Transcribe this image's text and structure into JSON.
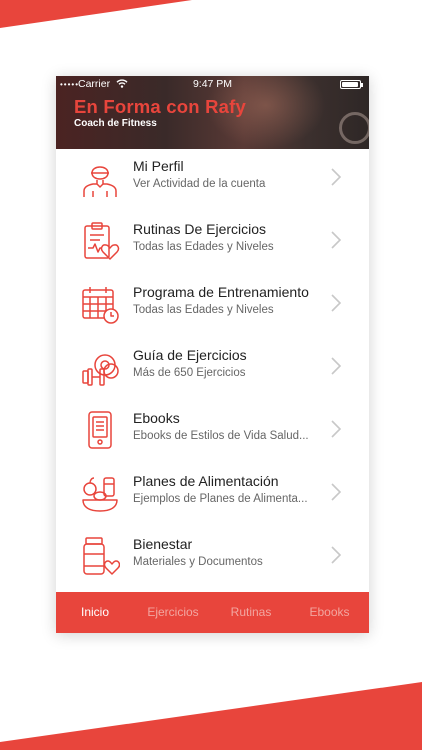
{
  "header": {
    "title": "En Forma con Rafy",
    "subtitle": "Coach de Fitness"
  },
  "status_bar": {
    "carrier": "Carrier",
    "time": "9:47 PM"
  },
  "menu": {
    "items": [
      {
        "title": "Mi Perfil",
        "subtitle": "Ver Actividad de la cuenta",
        "icon": "user-profile-icon"
      },
      {
        "title": "Rutinas De Ejercicios",
        "subtitle": "Todas las Edades y Niveles",
        "icon": "clipboard-heart-icon"
      },
      {
        "title": "Programa de Entrenamiento",
        "subtitle": "Todas las Edades y Niveles",
        "icon": "calendar-clock-icon"
      },
      {
        "title": "Guía de Ejercicios",
        "subtitle": "Más de 650 Ejercicios",
        "icon": "dumbbell-plates-icon"
      },
      {
        "title": "Ebooks",
        "subtitle": "Ebooks de Estilos de Vida Salud...",
        "icon": "ebook-reader-icon"
      },
      {
        "title": "Planes de Alimentación",
        "subtitle": "Ejemplos de Planes de Alimenta...",
        "icon": "food-plate-icon"
      },
      {
        "title": "Bienestar",
        "subtitle": "Materiales y Documentos",
        "icon": "wellness-jar-icon"
      }
    ]
  },
  "tabs": [
    {
      "label": "Inicio",
      "active": true
    },
    {
      "label": "Ejercicios",
      "active": false
    },
    {
      "label": "Rutinas",
      "active": false
    },
    {
      "label": "Ebooks",
      "active": false
    }
  ],
  "colors": {
    "accent": "#e8453c",
    "tab_inactive": "#f2a6a0"
  }
}
